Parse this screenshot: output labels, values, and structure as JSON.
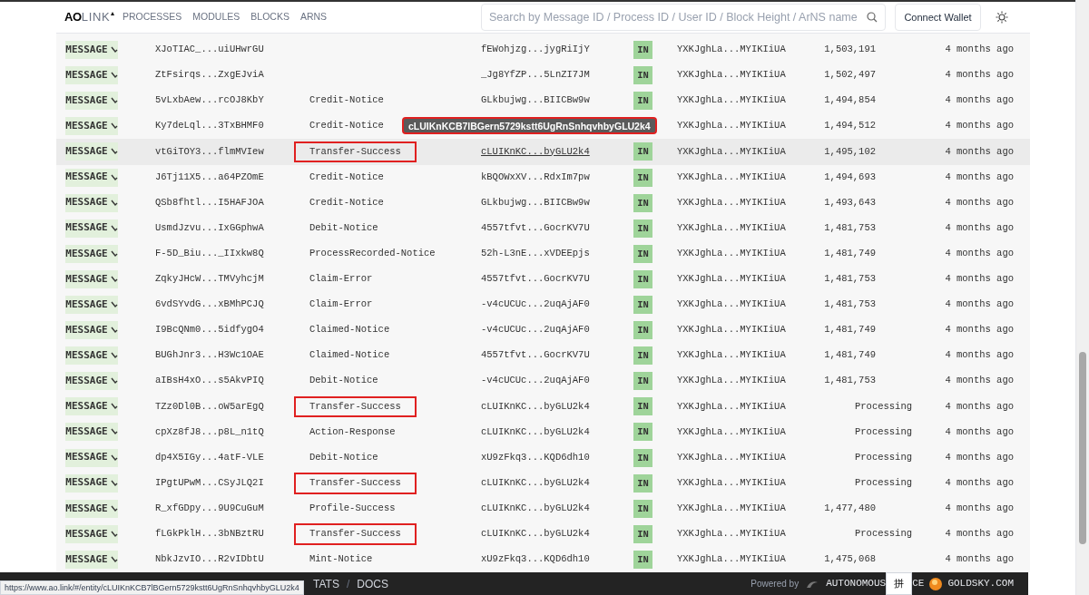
{
  "nav": {
    "logo_bold": "AO",
    "logo_light": "LINK",
    "items": [
      "PROCESSES",
      "MODULES",
      "BLOCKS",
      "ARNS"
    ],
    "search_placeholder": "Search by Message ID / Process ID / User ID / Block Height / ArNS name",
    "connect_button": "Connect Wallet"
  },
  "rows": [
    {
      "type": "MESSAGE",
      "id": "XJoTIAC_...uiUHwrGU",
      "action": "",
      "to": "fEWohjzg...jygRiIjY",
      "direction": "IN",
      "from": "YXKJghLa...MYIKIiUA",
      "block": "1,503,191",
      "pending": false,
      "time": "4 months ago",
      "hovered": false,
      "annotated": false
    },
    {
      "type": "MESSAGE",
      "id": "ZtFsirqs...ZxgEJviA",
      "action": "",
      "to": "_Jg8YfZP...5LnZI7JM",
      "direction": "IN",
      "from": "YXKJghLa...MYIKIiUA",
      "block": "1,502,497",
      "pending": false,
      "time": "4 months ago",
      "hovered": false,
      "annotated": false
    },
    {
      "type": "MESSAGE",
      "id": "5vLxbAew...rcOJ8KbY",
      "action": "Credit-Notice",
      "to": "GLkbujwg...BIICBw9w",
      "direction": "IN",
      "from": "YXKJghLa...MYIKIiUA",
      "block": "1,494,854",
      "pending": false,
      "time": "4 months ago",
      "hovered": false,
      "annotated": false
    },
    {
      "type": "MESSAGE",
      "id": "Ky7deLql...3TxBHMF0",
      "action": "Credit-Notice",
      "from": "YXKJghLa...MYIKIiUA",
      "block": "1,494,512",
      "pending": false,
      "time": "4 months ago",
      "hovered": false,
      "annotated": false,
      "tooltip": "cLUIKnKCB7lBGern5729kstt6UgRnSnhqvhbyGLU2k4"
    },
    {
      "type": "MESSAGE",
      "id": "vtGiTOY3...flmMVIew",
      "action": "Transfer-Success",
      "to": "cLUIKnKC...byGLU2k4",
      "direction": "IN",
      "from": "YXKJghLa...MYIKIiUA",
      "block": "1,495,102",
      "pending": false,
      "time": "4 months ago",
      "hovered": true,
      "annotated": true
    },
    {
      "type": "MESSAGE",
      "id": "J6Tj11X5...a64PZOmE",
      "action": "Credit-Notice",
      "to": "kBQOWxXV...RdxIm7pw",
      "direction": "IN",
      "from": "YXKJghLa...MYIKIiUA",
      "block": "1,494,693",
      "pending": false,
      "time": "4 months ago",
      "hovered": false,
      "annotated": false
    },
    {
      "type": "MESSAGE",
      "id": "QSb8fhtl...I5HAFJOA",
      "action": "Credit-Notice",
      "to": "GLkbujwg...BIICBw9w",
      "direction": "IN",
      "from": "YXKJghLa...MYIKIiUA",
      "block": "1,493,643",
      "pending": false,
      "time": "4 months ago",
      "hovered": false,
      "annotated": false
    },
    {
      "type": "MESSAGE",
      "id": "UsmdJzvu...IxGGphwA",
      "action": "Debit-Notice",
      "to": "4557tfvt...GocrKV7U",
      "direction": "IN",
      "from": "YXKJghLa...MYIKIiUA",
      "block": "1,481,753",
      "pending": false,
      "time": "4 months ago",
      "hovered": false,
      "annotated": false
    },
    {
      "type": "MESSAGE",
      "id": "F-5D_Biu..._IIxkw8Q",
      "action": "ProcessRecorded-Notice",
      "to": "52h-L3nE...xVDEEpjs",
      "direction": "IN",
      "from": "YXKJghLa...MYIKIiUA",
      "block": "1,481,749",
      "pending": false,
      "time": "4 months ago",
      "hovered": false,
      "annotated": false
    },
    {
      "type": "MESSAGE",
      "id": "ZqkyJHcW...TMVyhcjM",
      "action": "Claim-Error",
      "to": "4557tfvt...GocrKV7U",
      "direction": "IN",
      "from": "YXKJghLa...MYIKIiUA",
      "block": "1,481,753",
      "pending": false,
      "time": "4 months ago",
      "hovered": false,
      "annotated": false
    },
    {
      "type": "MESSAGE",
      "id": "6vdSYvdG...xBMhPCJQ",
      "action": "Claim-Error",
      "to": "-v4cUCUc...2uqAjAF0",
      "direction": "IN",
      "from": "YXKJghLa...MYIKIiUA",
      "block": "1,481,753",
      "pending": false,
      "time": "4 months ago",
      "hovered": false,
      "annotated": false
    },
    {
      "type": "MESSAGE",
      "id": "I9BcQNm0...5idfygO4",
      "action": "Claimed-Notice",
      "to": "-v4cUCUc...2uqAjAF0",
      "direction": "IN",
      "from": "YXKJghLa...MYIKIiUA",
      "block": "1,481,749",
      "pending": false,
      "time": "4 months ago",
      "hovered": false,
      "annotated": false
    },
    {
      "type": "MESSAGE",
      "id": "BUGhJnr3...H3Wc1OAE",
      "action": "Claimed-Notice",
      "to": "4557tfvt...GocrKV7U",
      "direction": "IN",
      "from": "YXKJghLa...MYIKIiUA",
      "block": "1,481,749",
      "pending": false,
      "time": "4 months ago",
      "hovered": false,
      "annotated": false
    },
    {
      "type": "MESSAGE",
      "id": "aIBsH4xO...s5AkvPIQ",
      "action": "Debit-Notice",
      "to": "-v4cUCUc...2uqAjAF0",
      "direction": "IN",
      "from": "YXKJghLa...MYIKIiUA",
      "block": "1,481,753",
      "pending": false,
      "time": "4 months ago",
      "hovered": false,
      "annotated": false
    },
    {
      "type": "MESSAGE",
      "id": "TZz0Dl0B...oW5arEgQ",
      "action": "Transfer-Success",
      "to": "cLUIKnKC...byGLU2k4",
      "direction": "IN",
      "from": "YXKJghLa...MYIKIiUA",
      "block": "Processing",
      "pending": true,
      "time": "4 months ago",
      "hovered": false,
      "annotated": true
    },
    {
      "type": "MESSAGE",
      "id": "cpXz8fJ8...p8L_n1tQ",
      "action": "Action-Response",
      "to": "cLUIKnKC...byGLU2k4",
      "direction": "IN",
      "from": "YXKJghLa...MYIKIiUA",
      "block": "Processing",
      "pending": true,
      "time": "4 months ago",
      "hovered": false,
      "annotated": false
    },
    {
      "type": "MESSAGE",
      "id": "dp4X5IGy...4atF-VLE",
      "action": "Debit-Notice",
      "to": "xU9zFkq3...KQD6dh10",
      "direction": "IN",
      "from": "YXKJghLa...MYIKIiUA",
      "block": "Processing",
      "pending": true,
      "time": "4 months ago",
      "hovered": false,
      "annotated": false
    },
    {
      "type": "MESSAGE",
      "id": "IPgtUPwM...CSyJLQ2I",
      "action": "Transfer-Success",
      "to": "cLUIKnKC...byGLU2k4",
      "direction": "IN",
      "from": "YXKJghLa...MYIKIiUA",
      "block": "Processing",
      "pending": true,
      "time": "4 months ago",
      "hovered": false,
      "annotated": true
    },
    {
      "type": "MESSAGE",
      "id": "R_xfGDpy...9U9CuGuM",
      "action": "Profile-Success",
      "to": "cLUIKnKC...byGLU2k4",
      "direction": "IN",
      "from": "YXKJghLa...MYIKIiUA",
      "block": "1,477,480",
      "pending": false,
      "time": "4 months ago",
      "hovered": false,
      "annotated": false
    },
    {
      "type": "MESSAGE",
      "id": "fLGkPklH...3bNBztRU",
      "action": "Transfer-Success",
      "to": "cLUIKnKC...byGLU2k4",
      "direction": "IN",
      "from": "YXKJghLa...MYIKIiUA",
      "block": "Processing",
      "pending": true,
      "time": "4 months ago",
      "hovered": false,
      "annotated": true
    },
    {
      "type": "MESSAGE",
      "id": "NbkJzvIO...R2vIDbtU",
      "action": "Mint-Notice",
      "to": "xU9zFkq3...KQD6dh10",
      "direction": "IN",
      "from": "YXKJghLa...MYIKIiUA",
      "block": "1,475,068",
      "pending": false,
      "time": "4 months ago",
      "hovered": false,
      "annotated": false
    }
  ],
  "footer": {
    "links": [
      "TATS",
      "DOCS"
    ],
    "separator": "/",
    "powered_by": "Powered by",
    "brand_left": "AUTONOMOUS",
    "brand_right": "CE",
    "brand2": "GOLDSKY.COM"
  },
  "status_url": "https://www.ao.link/#/entity/cLUIKnKCB7lBGern5729kstt6UgRnSnhqvhbyGLU2k4",
  "ime": "拼"
}
